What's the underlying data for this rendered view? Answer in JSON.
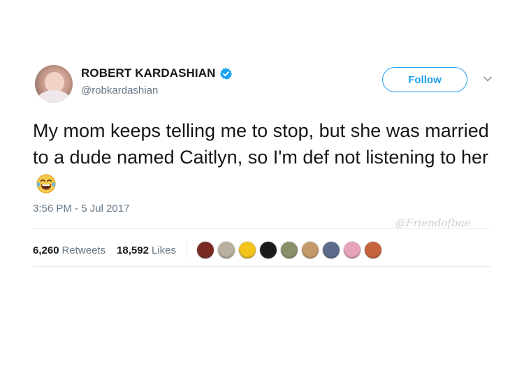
{
  "tweet": {
    "display_name": "ROBERT KARDASHIAN",
    "handle": "@robkardashian",
    "follow_label": "Follow",
    "text": "My mom keeps telling me to stop, but she was married to a dude named Caitlyn, so I'm def not listening to her",
    "emoji": "face-with-tears-of-joy",
    "timestamp": "3:56 PM - 5 Jul 2017",
    "retweets_count": "6,260",
    "retweets_label": "Retweets",
    "likes_count": "18,592",
    "likes_label": "Likes",
    "watermark": "@Friendofbae"
  },
  "colors": {
    "accent": "#1da1f2",
    "secondary_text": "#657786",
    "primary_text": "#14171a"
  },
  "likers": [
    {
      "color": "#7a2a22"
    },
    {
      "color": "#b9b0a0"
    },
    {
      "color": "#f3c21b"
    },
    {
      "color": "#1b1b1b"
    },
    {
      "color": "#8a8f6a"
    },
    {
      "color": "#c59a6b"
    },
    {
      "color": "#5c6b8a"
    },
    {
      "color": "#e7a3b8"
    },
    {
      "color": "#c7623f"
    }
  ]
}
